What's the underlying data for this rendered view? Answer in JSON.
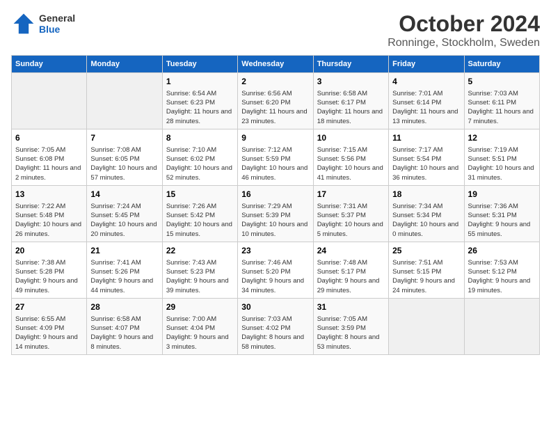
{
  "header": {
    "logo_general": "General",
    "logo_blue": "Blue",
    "title": "October 2024",
    "subtitle": "Ronninge, Stockholm, Sweden"
  },
  "days_of_week": [
    "Sunday",
    "Monday",
    "Tuesday",
    "Wednesday",
    "Thursday",
    "Friday",
    "Saturday"
  ],
  "weeks": [
    [
      {
        "day": "",
        "empty": true
      },
      {
        "day": "",
        "empty": true
      },
      {
        "day": "1",
        "sunrise": "Sunrise: 6:54 AM",
        "sunset": "Sunset: 6:23 PM",
        "daylight": "Daylight: 11 hours and 28 minutes."
      },
      {
        "day": "2",
        "sunrise": "Sunrise: 6:56 AM",
        "sunset": "Sunset: 6:20 PM",
        "daylight": "Daylight: 11 hours and 23 minutes."
      },
      {
        "day": "3",
        "sunrise": "Sunrise: 6:58 AM",
        "sunset": "Sunset: 6:17 PM",
        "daylight": "Daylight: 11 hours and 18 minutes."
      },
      {
        "day": "4",
        "sunrise": "Sunrise: 7:01 AM",
        "sunset": "Sunset: 6:14 PM",
        "daylight": "Daylight: 11 hours and 13 minutes."
      },
      {
        "day": "5",
        "sunrise": "Sunrise: 7:03 AM",
        "sunset": "Sunset: 6:11 PM",
        "daylight": "Daylight: 11 hours and 7 minutes."
      }
    ],
    [
      {
        "day": "6",
        "sunrise": "Sunrise: 7:05 AM",
        "sunset": "Sunset: 6:08 PM",
        "daylight": "Daylight: 11 hours and 2 minutes."
      },
      {
        "day": "7",
        "sunrise": "Sunrise: 7:08 AM",
        "sunset": "Sunset: 6:05 PM",
        "daylight": "Daylight: 10 hours and 57 minutes."
      },
      {
        "day": "8",
        "sunrise": "Sunrise: 7:10 AM",
        "sunset": "Sunset: 6:02 PM",
        "daylight": "Daylight: 10 hours and 52 minutes."
      },
      {
        "day": "9",
        "sunrise": "Sunrise: 7:12 AM",
        "sunset": "Sunset: 5:59 PM",
        "daylight": "Daylight: 10 hours and 46 minutes."
      },
      {
        "day": "10",
        "sunrise": "Sunrise: 7:15 AM",
        "sunset": "Sunset: 5:56 PM",
        "daylight": "Daylight: 10 hours and 41 minutes."
      },
      {
        "day": "11",
        "sunrise": "Sunrise: 7:17 AM",
        "sunset": "Sunset: 5:54 PM",
        "daylight": "Daylight: 10 hours and 36 minutes."
      },
      {
        "day": "12",
        "sunrise": "Sunrise: 7:19 AM",
        "sunset": "Sunset: 5:51 PM",
        "daylight": "Daylight: 10 hours and 31 minutes."
      }
    ],
    [
      {
        "day": "13",
        "sunrise": "Sunrise: 7:22 AM",
        "sunset": "Sunset: 5:48 PM",
        "daylight": "Daylight: 10 hours and 26 minutes."
      },
      {
        "day": "14",
        "sunrise": "Sunrise: 7:24 AM",
        "sunset": "Sunset: 5:45 PM",
        "daylight": "Daylight: 10 hours and 20 minutes."
      },
      {
        "day": "15",
        "sunrise": "Sunrise: 7:26 AM",
        "sunset": "Sunset: 5:42 PM",
        "daylight": "Daylight: 10 hours and 15 minutes."
      },
      {
        "day": "16",
        "sunrise": "Sunrise: 7:29 AM",
        "sunset": "Sunset: 5:39 PM",
        "daylight": "Daylight: 10 hours and 10 minutes."
      },
      {
        "day": "17",
        "sunrise": "Sunrise: 7:31 AM",
        "sunset": "Sunset: 5:37 PM",
        "daylight": "Daylight: 10 hours and 5 minutes."
      },
      {
        "day": "18",
        "sunrise": "Sunrise: 7:34 AM",
        "sunset": "Sunset: 5:34 PM",
        "daylight": "Daylight: 10 hours and 0 minutes."
      },
      {
        "day": "19",
        "sunrise": "Sunrise: 7:36 AM",
        "sunset": "Sunset: 5:31 PM",
        "daylight": "Daylight: 9 hours and 55 minutes."
      }
    ],
    [
      {
        "day": "20",
        "sunrise": "Sunrise: 7:38 AM",
        "sunset": "Sunset: 5:28 PM",
        "daylight": "Daylight: 9 hours and 49 minutes."
      },
      {
        "day": "21",
        "sunrise": "Sunrise: 7:41 AM",
        "sunset": "Sunset: 5:26 PM",
        "daylight": "Daylight: 9 hours and 44 minutes."
      },
      {
        "day": "22",
        "sunrise": "Sunrise: 7:43 AM",
        "sunset": "Sunset: 5:23 PM",
        "daylight": "Daylight: 9 hours and 39 minutes."
      },
      {
        "day": "23",
        "sunrise": "Sunrise: 7:46 AM",
        "sunset": "Sunset: 5:20 PM",
        "daylight": "Daylight: 9 hours and 34 minutes."
      },
      {
        "day": "24",
        "sunrise": "Sunrise: 7:48 AM",
        "sunset": "Sunset: 5:17 PM",
        "daylight": "Daylight: 9 hours and 29 minutes."
      },
      {
        "day": "25",
        "sunrise": "Sunrise: 7:51 AM",
        "sunset": "Sunset: 5:15 PM",
        "daylight": "Daylight: 9 hours and 24 minutes."
      },
      {
        "day": "26",
        "sunrise": "Sunrise: 7:53 AM",
        "sunset": "Sunset: 5:12 PM",
        "daylight": "Daylight: 9 hours and 19 minutes."
      }
    ],
    [
      {
        "day": "27",
        "sunrise": "Sunrise: 6:55 AM",
        "sunset": "Sunset: 4:09 PM",
        "daylight": "Daylight: 9 hours and 14 minutes."
      },
      {
        "day": "28",
        "sunrise": "Sunrise: 6:58 AM",
        "sunset": "Sunset: 4:07 PM",
        "daylight": "Daylight: 9 hours and 8 minutes."
      },
      {
        "day": "29",
        "sunrise": "Sunrise: 7:00 AM",
        "sunset": "Sunset: 4:04 PM",
        "daylight": "Daylight: 9 hours and 3 minutes."
      },
      {
        "day": "30",
        "sunrise": "Sunrise: 7:03 AM",
        "sunset": "Sunset: 4:02 PM",
        "daylight": "Daylight: 8 hours and 58 minutes."
      },
      {
        "day": "31",
        "sunrise": "Sunrise: 7:05 AM",
        "sunset": "Sunset: 3:59 PM",
        "daylight": "Daylight: 8 hours and 53 minutes."
      },
      {
        "day": "",
        "empty": true
      },
      {
        "day": "",
        "empty": true
      }
    ]
  ]
}
